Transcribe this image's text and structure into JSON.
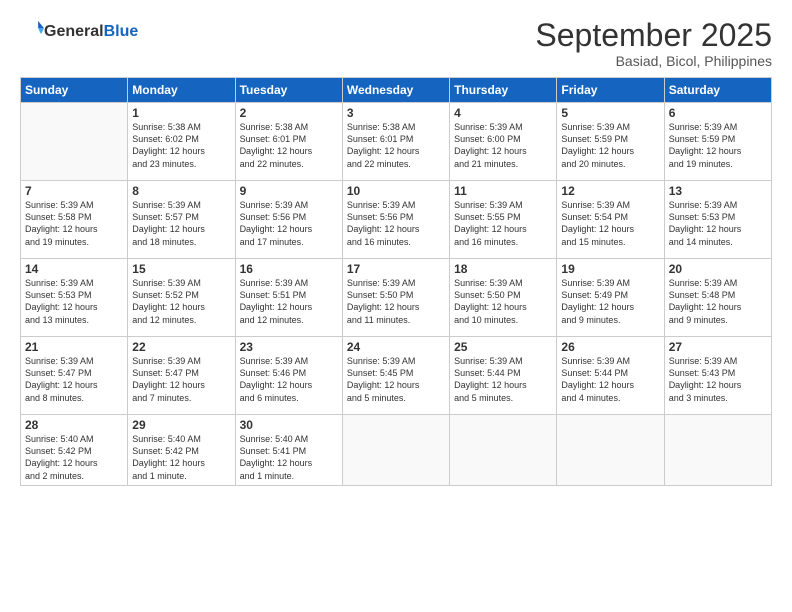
{
  "header": {
    "logo_general": "General",
    "logo_blue": "Blue",
    "month_title": "September 2025",
    "location": "Basiad, Bicol, Philippines"
  },
  "days_of_week": [
    "Sunday",
    "Monday",
    "Tuesday",
    "Wednesday",
    "Thursday",
    "Friday",
    "Saturday"
  ],
  "weeks": [
    [
      {
        "day": "",
        "info": ""
      },
      {
        "day": "1",
        "info": "Sunrise: 5:38 AM\nSunset: 6:02 PM\nDaylight: 12 hours\nand 23 minutes."
      },
      {
        "day": "2",
        "info": "Sunrise: 5:38 AM\nSunset: 6:01 PM\nDaylight: 12 hours\nand 22 minutes."
      },
      {
        "day": "3",
        "info": "Sunrise: 5:38 AM\nSunset: 6:01 PM\nDaylight: 12 hours\nand 22 minutes."
      },
      {
        "day": "4",
        "info": "Sunrise: 5:39 AM\nSunset: 6:00 PM\nDaylight: 12 hours\nand 21 minutes."
      },
      {
        "day": "5",
        "info": "Sunrise: 5:39 AM\nSunset: 5:59 PM\nDaylight: 12 hours\nand 20 minutes."
      },
      {
        "day": "6",
        "info": "Sunrise: 5:39 AM\nSunset: 5:59 PM\nDaylight: 12 hours\nand 19 minutes."
      }
    ],
    [
      {
        "day": "7",
        "info": "Sunrise: 5:39 AM\nSunset: 5:58 PM\nDaylight: 12 hours\nand 19 minutes."
      },
      {
        "day": "8",
        "info": "Sunrise: 5:39 AM\nSunset: 5:57 PM\nDaylight: 12 hours\nand 18 minutes."
      },
      {
        "day": "9",
        "info": "Sunrise: 5:39 AM\nSunset: 5:56 PM\nDaylight: 12 hours\nand 17 minutes."
      },
      {
        "day": "10",
        "info": "Sunrise: 5:39 AM\nSunset: 5:56 PM\nDaylight: 12 hours\nand 16 minutes."
      },
      {
        "day": "11",
        "info": "Sunrise: 5:39 AM\nSunset: 5:55 PM\nDaylight: 12 hours\nand 16 minutes."
      },
      {
        "day": "12",
        "info": "Sunrise: 5:39 AM\nSunset: 5:54 PM\nDaylight: 12 hours\nand 15 minutes."
      },
      {
        "day": "13",
        "info": "Sunrise: 5:39 AM\nSunset: 5:53 PM\nDaylight: 12 hours\nand 14 minutes."
      }
    ],
    [
      {
        "day": "14",
        "info": "Sunrise: 5:39 AM\nSunset: 5:53 PM\nDaylight: 12 hours\nand 13 minutes."
      },
      {
        "day": "15",
        "info": "Sunrise: 5:39 AM\nSunset: 5:52 PM\nDaylight: 12 hours\nand 12 minutes."
      },
      {
        "day": "16",
        "info": "Sunrise: 5:39 AM\nSunset: 5:51 PM\nDaylight: 12 hours\nand 12 minutes."
      },
      {
        "day": "17",
        "info": "Sunrise: 5:39 AM\nSunset: 5:50 PM\nDaylight: 12 hours\nand 11 minutes."
      },
      {
        "day": "18",
        "info": "Sunrise: 5:39 AM\nSunset: 5:50 PM\nDaylight: 12 hours\nand 10 minutes."
      },
      {
        "day": "19",
        "info": "Sunrise: 5:39 AM\nSunset: 5:49 PM\nDaylight: 12 hours\nand 9 minutes."
      },
      {
        "day": "20",
        "info": "Sunrise: 5:39 AM\nSunset: 5:48 PM\nDaylight: 12 hours\nand 9 minutes."
      }
    ],
    [
      {
        "day": "21",
        "info": "Sunrise: 5:39 AM\nSunset: 5:47 PM\nDaylight: 12 hours\nand 8 minutes."
      },
      {
        "day": "22",
        "info": "Sunrise: 5:39 AM\nSunset: 5:47 PM\nDaylight: 12 hours\nand 7 minutes."
      },
      {
        "day": "23",
        "info": "Sunrise: 5:39 AM\nSunset: 5:46 PM\nDaylight: 12 hours\nand 6 minutes."
      },
      {
        "day": "24",
        "info": "Sunrise: 5:39 AM\nSunset: 5:45 PM\nDaylight: 12 hours\nand 5 minutes."
      },
      {
        "day": "25",
        "info": "Sunrise: 5:39 AM\nSunset: 5:44 PM\nDaylight: 12 hours\nand 5 minutes."
      },
      {
        "day": "26",
        "info": "Sunrise: 5:39 AM\nSunset: 5:44 PM\nDaylight: 12 hours\nand 4 minutes."
      },
      {
        "day": "27",
        "info": "Sunrise: 5:39 AM\nSunset: 5:43 PM\nDaylight: 12 hours\nand 3 minutes."
      }
    ],
    [
      {
        "day": "28",
        "info": "Sunrise: 5:40 AM\nSunset: 5:42 PM\nDaylight: 12 hours\nand 2 minutes."
      },
      {
        "day": "29",
        "info": "Sunrise: 5:40 AM\nSunset: 5:42 PM\nDaylight: 12 hours\nand 1 minute."
      },
      {
        "day": "30",
        "info": "Sunrise: 5:40 AM\nSunset: 5:41 PM\nDaylight: 12 hours\nand 1 minute."
      },
      {
        "day": "",
        "info": ""
      },
      {
        "day": "",
        "info": ""
      },
      {
        "day": "",
        "info": ""
      },
      {
        "day": "",
        "info": ""
      }
    ]
  ]
}
